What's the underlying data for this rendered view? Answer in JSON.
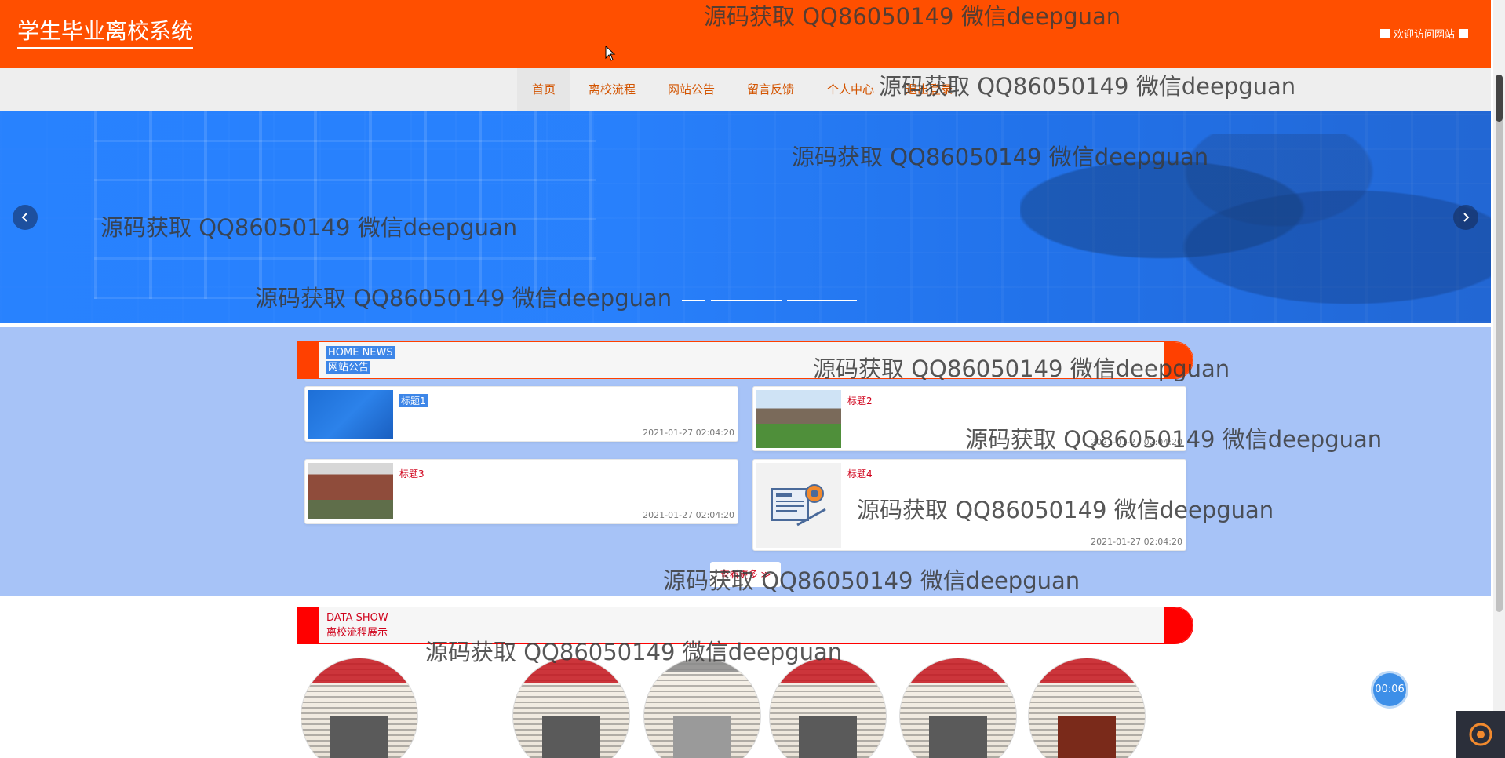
{
  "header": {
    "site_title": "学生毕业离校系统",
    "welcome": "欢迎访问网站"
  },
  "nav": {
    "items": [
      {
        "label": "首页"
      },
      {
        "label": "离校流程"
      },
      {
        "label": "网站公告"
      },
      {
        "label": "留言反馈"
      },
      {
        "label": "个人中心"
      },
      {
        "label": "退出登录"
      }
    ]
  },
  "news": {
    "header_en": "HOME NEWS",
    "header_zh": "网站公告",
    "items": [
      {
        "title": "标题1",
        "date": "2021-01-27 02:04:20"
      },
      {
        "title": "标题2",
        "date": "2021-01-27 02:04:20"
      },
      {
        "title": "标题3",
        "date": "2021-01-27 02:04:20"
      },
      {
        "title": "标题4",
        "date": "2021-01-27 02:04:20"
      }
    ],
    "more_label": "查看更多 ≫"
  },
  "process": {
    "header_en": "DATA SHOW",
    "header_zh": "离校流程展示"
  },
  "widgets": {
    "timer": "00:06"
  },
  "watermark": "源码获取 QQ86050149 微信deepguan",
  "colors": {
    "header_bg": "#ff4f00",
    "nav_text": "#d35400",
    "news_section_bg": "#a7c3f7",
    "accent_red": "#ff0000",
    "title_red": "#d0021b"
  }
}
